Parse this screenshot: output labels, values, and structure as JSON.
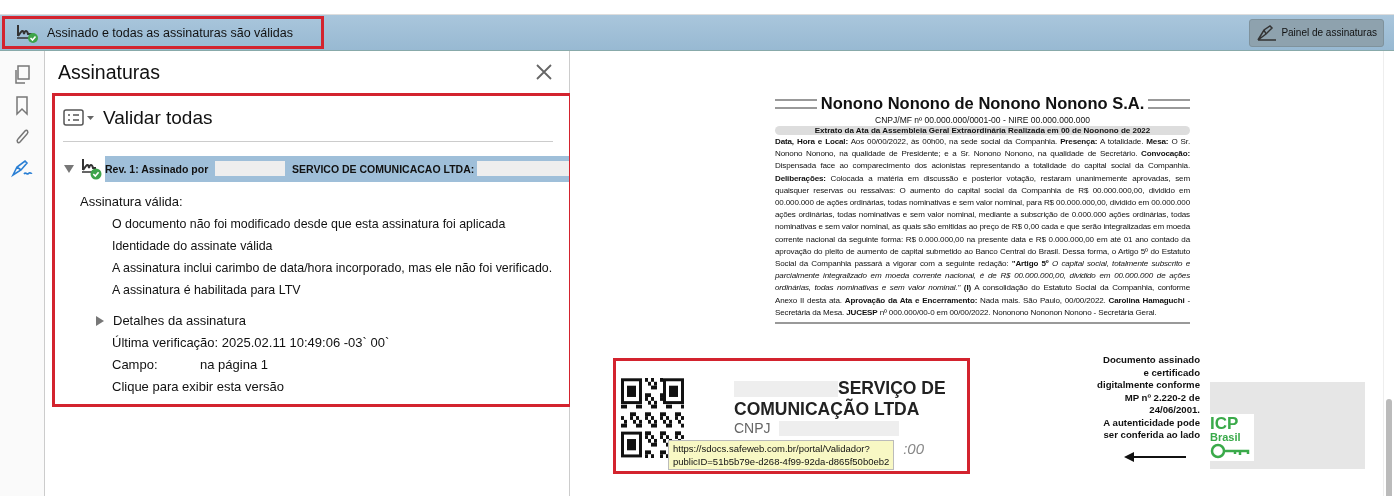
{
  "status_bar": {
    "text": "Assinado e todas as assinaturas são válidas"
  },
  "signature_panel_button": {
    "label": "Painel de assinaturas"
  },
  "sidebar": {
    "tools": [
      {
        "kind": "pages",
        "selected": false
      },
      {
        "kind": "bookmark",
        "selected": false
      },
      {
        "kind": "attachment",
        "selected": false
      },
      {
        "kind": "signature",
        "selected": true
      }
    ]
  },
  "panel": {
    "title": "Assinaturas",
    "validate_all": "Validar todas",
    "signature": {
      "selected": true,
      "expanded": true,
      "prefix": "Rev. 1: Assinado por",
      "company": "SERVICO DE COMUNICACAO LTDA:",
      "status": "Assinatura válida:",
      "checks": [
        "O documento não foi modificado desde que esta assinatura foi aplicada",
        "Identidade do assinate válida",
        "A assinatura inclui carimbo de data/hora incorporado, mas ele não foi verificado.",
        "A assinatura é habilitada para LTV"
      ],
      "details": {
        "label": "Detalhes da assinatura",
        "expanded": false
      },
      "last_check": "Última verificação: 2025.02.11  10:49:06 -03` 00`",
      "field_label": "Campo:",
      "field_value": "na página 1",
      "show_version": "Clique para exibir esta versão"
    }
  },
  "document": {
    "heading": "Nonono Nonono de Nonono Nonono S.A.",
    "registry": "CNPJ/MF nº 00.000.000/0001-00 - NIRE 00.000.000.000",
    "band": "Extrato da Ata da Assembleia Geral Extraordinária Realizada em 00 de Noonono de 2022",
    "body": "**Data, Hora e Local:** Aos 00/00/2022, às 00h00, na sede social da Companhia. **Presença:** A totalidade. **Mesa:** O Sr. Nonono Nonono, na qualidade de Presidente; e a Sr. Nonono Nonono, na qualidade de Secretário. **Convocação:** Dispensada face ao comparecimento dos acionistas representando a totalidade do capital social da Companhia. **Deliberações:** Colocada a matéria em discussão e posterior votação, restaram unanimemente aprovadas, sem quaisquer reservas ou ressalvas: O aumento do capital social da Companhia de R$ 00.000.000,00, dividido em 00.000.000 de ações ordinárias, todas nominativas e sem valor nominal, para R$ 00.000.000,00, dividido em 00.000.000 ações ordinárias, todas nominativas e sem valor nominal, mediante a subscrição de 0.000.000 ações ordinárias, todas nominativas e sem valor nominal, as quais são emitidas ao preço de R$ 0,00 cada e que serão integralizadas em moeda corrente nacional da seguinte forma: R$ 0.000.000,00 na presente data e R$ 0.000.000,00 em até 01 ano contado da aprovação do pleito de aumento de capital submetido ao Banco Central do Brasil. Dessa forma, o Artigo 5º do Estatuto Social da Companhia passará a vigorar com a seguinte redação: **\"Artigo 5º** *O capital social, totalmente subscrito e parcialmente integralizado em moeda corrente nacional, é de R$ 00.000.000,00, dividido em 00.000.000 de ações ordinárias, todas nominativas e sem valor nominal.\"* **(I)** A consolidação do Estatuto Social da Companhia, conforme Anexo II desta ata. **Aprovação da Ata e Encerramento:** Nada mais. São Paulo, 00/00/2022. **Carolina Hamaguchi** - Secretária da Mesa. **JUCESP** nº 000.000/00-0 em 00/00/2022. Nononono Nononon Nonono - Secretária Geral."
  },
  "stamp": {
    "company_line_1": "SERVIÇO DE",
    "company_line_2": "COMUNICAÇÃO LTDA",
    "cnpj_label": "CNPJ",
    "time_fragment": ":00",
    "tooltip": [
      "https://sdocs.safeweb.com.br/portal/Validador?",
      "publicID=51b5b79e-d268-4f99-92da-d865f50b0eb2"
    ]
  },
  "certification_note": {
    "lines": [
      "Documento assinado",
      "e certificado",
      "digitalmente conforme",
      "MP nº 2.220-2 de",
      "24/06/2001.",
      "A autenticidade pode",
      "ser conferida ao lado"
    ],
    "logo_top": "ICP",
    "logo_bottom": "Brasil"
  }
}
